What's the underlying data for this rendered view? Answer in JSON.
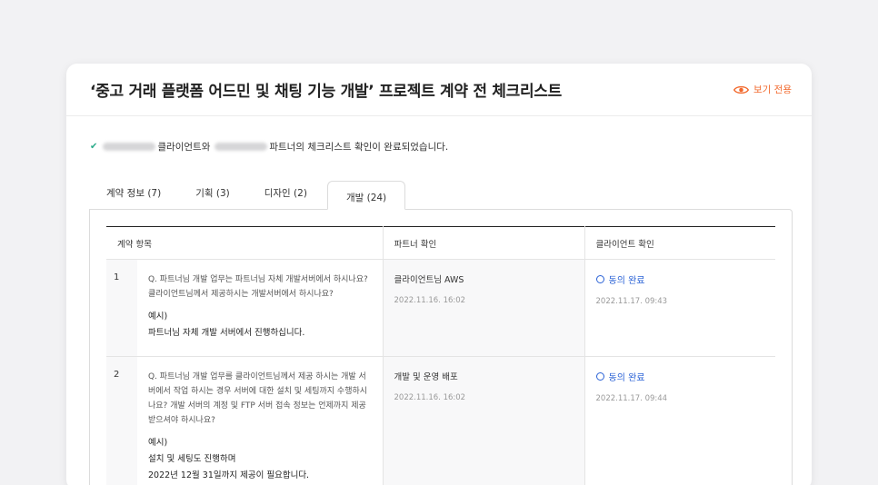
{
  "header": {
    "title": "‘중고 거래 플랫폼 어드민 및 채팅 기능 개발’ 프로젝트 계약 전 체크리스트",
    "readonly_label": "보기 전용",
    "accent_color": "#f26a2e"
  },
  "notice": {
    "part1": "클라이언트와",
    "part2": "파트너의 체크리스트 확인이 완료되었습니다."
  },
  "tabs": [
    {
      "label": "계약 정보 (7)"
    },
    {
      "label": "기획 (3)"
    },
    {
      "label": "디자인 (2)"
    },
    {
      "label": "개발 (24)"
    }
  ],
  "active_tab": "개발 (24)",
  "table": {
    "headers": [
      "계약 항목",
      "파트너 확인",
      "클라이언트 확인"
    ],
    "rows": [
      {
        "num": "1",
        "question": "Q. 파트너님 개발 업무는 파트너님 자체 개발서버에서 하시나요? 클라이언트님께서 제공하시는 개발서버에서 하시나요?",
        "example_label": "예시)",
        "example_lines": [
          "파트너님 자체 개발 서버에서 진행하십니다."
        ],
        "partner_answer": "클라이언트님 AWS",
        "partner_date": "2022.11.16. 16:02",
        "client_status": "동의 완료",
        "client_date": "2022.11.17. 09:43"
      },
      {
        "num": "2",
        "question": "Q. 파트너님 개발 업무를 클라이언트님께서 제공 하시는 개발 서버에서 작업 하시는 경우 서버에 대한 설치 및 세팅까지 수행하시나요? 개발 서버의 계정 및 FTP 서버 접속 정보는 언제까지 제공받으셔야 하시나요?",
        "example_label": "예시)",
        "example_lines": [
          "설치 및 세팅도 진행하며",
          "2022년 12월 31일까지 제공이 필요합니다."
        ],
        "partner_answer": "개발 및 운영 배포",
        "partner_date": "2022.11.16. 16:02",
        "client_status": "동의 완료",
        "client_date": "2022.11.17. 09:44"
      }
    ]
  },
  "colors": {
    "status_blue": "#2a62d6",
    "check_green": "#2bab8a"
  }
}
